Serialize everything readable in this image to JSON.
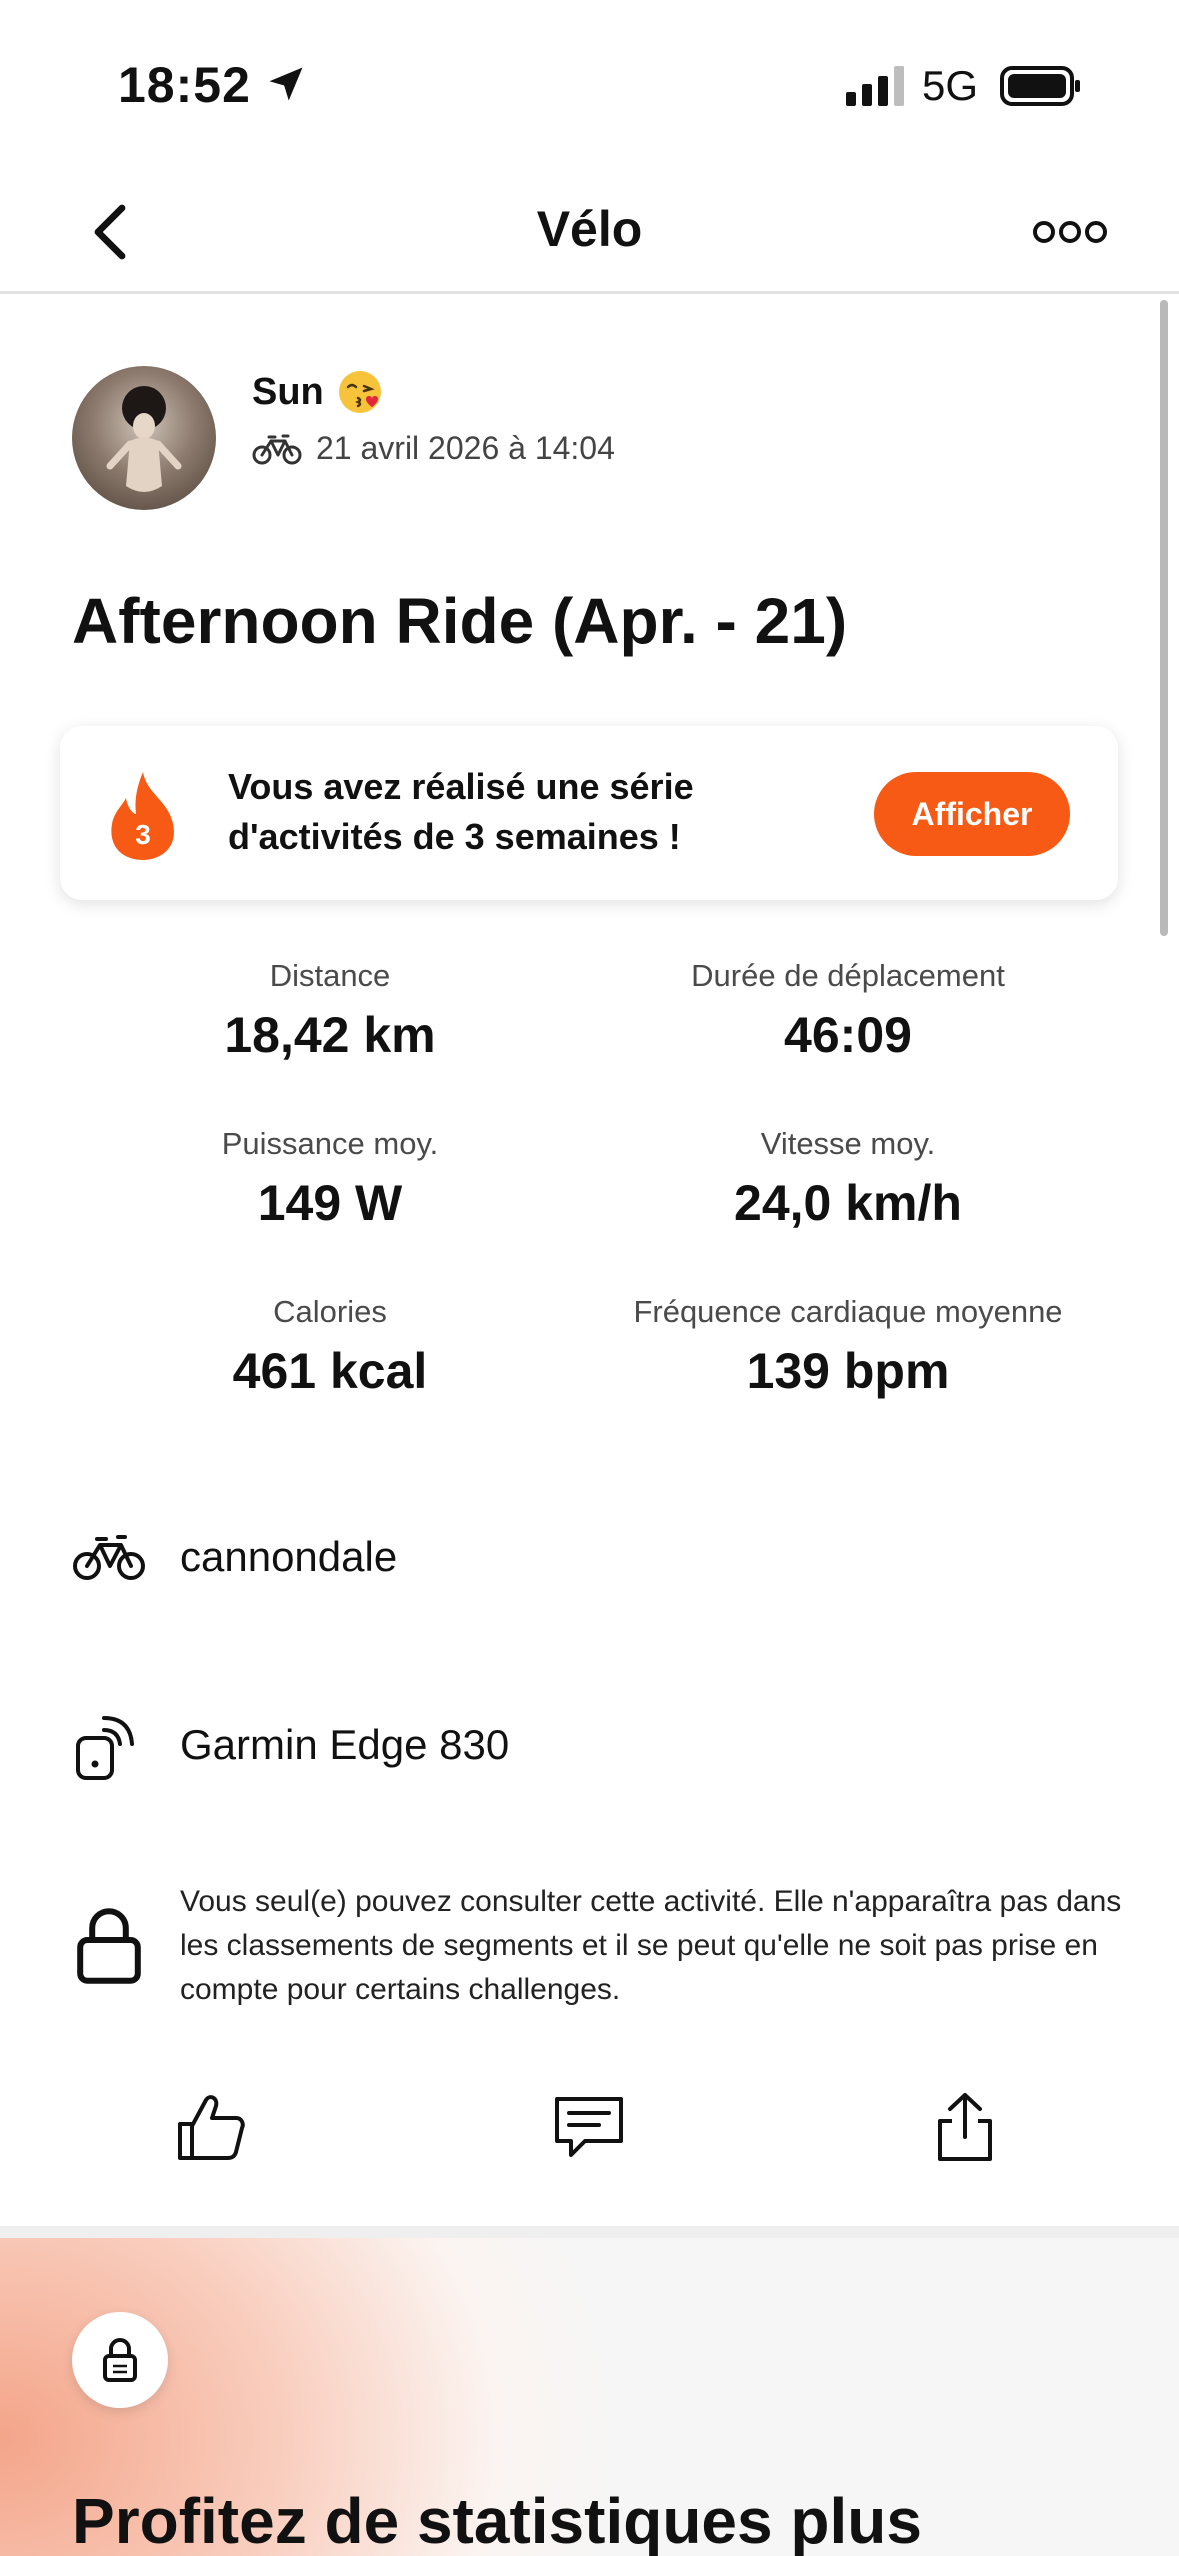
{
  "status_bar": {
    "time": "18:52",
    "network": "5G",
    "icons": [
      "location-arrow-icon",
      "signal-icon",
      "battery-icon"
    ]
  },
  "header": {
    "title": "Vélo",
    "back_icon": "chevron-left-icon",
    "more_icon": "more-dots-icon"
  },
  "athlete": {
    "name": "Sun",
    "emoji": "😘",
    "sport_icon": "bike-icon",
    "datetime": "21 avril 2026 à 14:04"
  },
  "activity": {
    "title": "Afternoon Ride (Apr. - 21)"
  },
  "streak": {
    "count": "3",
    "message": "Vous avez réalisé une série d'activités de 3 semaines !",
    "button_label": "Afficher",
    "accent": "#F65A14"
  },
  "stats": [
    {
      "label": "Distance",
      "value": "18,42 km"
    },
    {
      "label": "Durée de déplacement",
      "value": "46:09"
    },
    {
      "label": "Puissance moy.",
      "value": "149 W"
    },
    {
      "label": "Vitesse moy.",
      "value": "24,0 km/h"
    },
    {
      "label": "Calories",
      "value": "461 kcal"
    },
    {
      "label": "Fréquence cardiaque moyenne",
      "value": "139 bpm"
    }
  ],
  "gear": {
    "bike": "cannondale",
    "device": "Garmin Edge 830"
  },
  "privacy": {
    "text": "Vous seul(e) pouvez consulter cette activité. Elle n'apparaîtra pas dans les classements de segments et il se peut qu'elle ne soit pas prise en compte pour certains challenges."
  },
  "actions": [
    "thumbs-up-icon",
    "comment-icon",
    "share-icon"
  ],
  "upsell": {
    "title": "Profitez de statistiques plus",
    "icon": "lock-icon"
  }
}
